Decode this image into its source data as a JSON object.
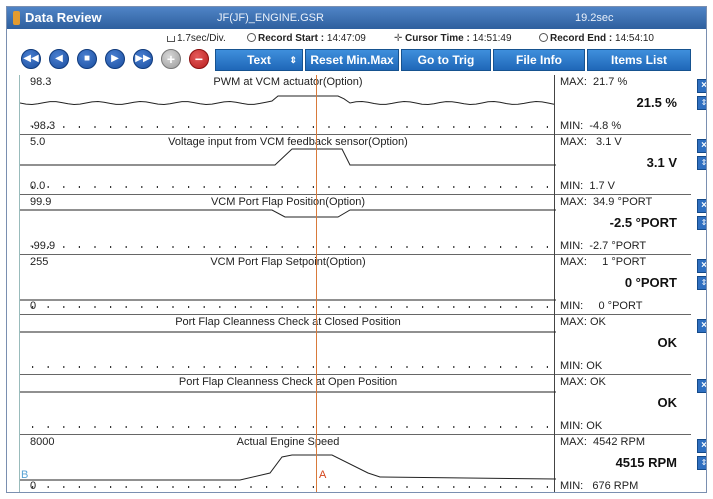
{
  "window": {
    "title": "Data Review",
    "file": "JF(JF)_ENGINE.GSR",
    "duration": "19.2sec"
  },
  "info": {
    "div": "1.7sec/Div.",
    "record_start_label": "Record Start :",
    "record_start": "14:47:09",
    "cursor_time_label": "Cursor Time :",
    "cursor_time": "14:51:49",
    "record_end_label": "Record End :",
    "record_end": "14:54:10"
  },
  "toolbar": {
    "nav": [
      {
        "name": "first-button",
        "icon": "◀◀"
      },
      {
        "name": "prev-button",
        "icon": "◀"
      },
      {
        "name": "stop-button",
        "icon": "■"
      },
      {
        "name": "next-button",
        "icon": "▶"
      },
      {
        "name": "last-button",
        "icon": "▶▶"
      }
    ],
    "add_icon": "+",
    "remove_icon": "−",
    "text_label": "Text",
    "text_arrow": "⇕",
    "reset_label": "Reset Min.Max",
    "trig_label": "Go to Trig",
    "fileinfo_label": "File Info",
    "items_label": "Items List"
  },
  "rows": [
    {
      "name": "PWM at VCM actuator(Option)",
      "ymax": "98.3",
      "ymin": "-98.3",
      "max": "MAX:  21.7 %",
      "value": "21.5 %",
      "min": "MIN:  -4.8 %",
      "kind": "pwm",
      "level": 0.56
    },
    {
      "name": "Voltage input from VCM feedback sensor(Option)",
      "ymax": "5.0",
      "ymin": "0.0",
      "max": "MAX:   3.1 V",
      "value": "3.1 V",
      "min": "MIN:  1.7 V",
      "kind": "step"
    },
    {
      "name": "VCM Port Flap Position(Option)",
      "ymax": "99.9",
      "ymin": "-99.9",
      "max": "MAX:  34.9 °PORT",
      "value": "-2.5 °PORT",
      "min": "MIN:  -2.7 °PORT",
      "kind": "dip"
    },
    {
      "name": "VCM Port Flap Setpoint(Option)",
      "ymax": "255",
      "ymin": "0",
      "max": "MAX:     1 °PORT",
      "value": "0 °PORT",
      "min": "MIN:     0 °PORT",
      "kind": "flat_low"
    },
    {
      "name": "Port Flap Cleanness Check at Closed Position",
      "ymax": "",
      "ymin": "",
      "max": "MAX: OK",
      "value": "OK",
      "min": "MIN: OK",
      "kind": "flat_mid"
    },
    {
      "name": "Port Flap Cleanness Check at Open Position",
      "ymax": "",
      "ymin": "",
      "max": "MAX: OK",
      "value": "OK",
      "min": "MIN: OK",
      "kind": "flat_mid"
    },
    {
      "name": "Actual Engine Speed",
      "ymax": "8000",
      "ymin": "0",
      "max": "MAX:  4542 RPM",
      "value": "4515 RPM",
      "min": "MIN:   676 RPM",
      "kind": "speed"
    }
  ],
  "cursor": {
    "a_label": "A",
    "b_label": "B"
  },
  "icons": {
    "close": "×",
    "stepper": "⇕"
  },
  "colors": {
    "title": "#2e5f9e",
    "button": "#1f67b8",
    "cursor": "#d87a3a"
  }
}
